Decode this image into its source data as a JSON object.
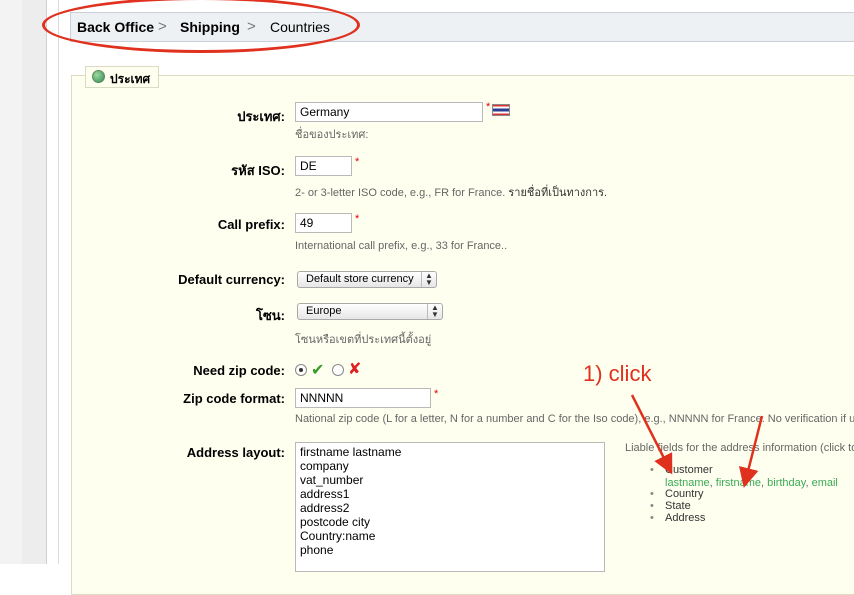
{
  "breadcrumb": {
    "items": [
      "Back Office",
      "Shipping",
      "Countries"
    ],
    "separator": ">"
  },
  "panel": {
    "legend": "ประเทศ"
  },
  "form": {
    "country": {
      "label": "ประเทศ:",
      "value": "Germany",
      "hint": "ชื่อของประเทศ:"
    },
    "iso": {
      "label": "รหัส ISO:",
      "value": "DE",
      "hint": "2- or 3-letter ISO code, e.g., FR for France.",
      "hint_link": "รายชื่อที่เป็นทางการ."
    },
    "call_prefix": {
      "label": "Call prefix:",
      "value": "49",
      "hint": "International call prefix, e.g., 33 for France.."
    },
    "default_currency": {
      "label": "Default currency:",
      "selected": "Default store currency"
    },
    "zone": {
      "label": "โซน:",
      "selected": "Europe",
      "hint": "โซนหรือเขตที่ประเทศนี้ตั้งอยู่"
    },
    "need_zip": {
      "label": "Need zip code:",
      "selected": "yes"
    },
    "zip_format": {
      "label": "Zip code format:",
      "value": "NNNNN",
      "hint": "National zip code (L for a letter, N for a number and C for the Iso code), e.g., NNNNN for France. No verification if u"
    },
    "address_layout": {
      "label": "Address layout:",
      "lines": [
        "firstname lastname",
        "company",
        "vat_number",
        "address1",
        "address2",
        "postcode city",
        "Country:name",
        "phone"
      ]
    },
    "liable_fields": {
      "intro": "Liable fields for the address information (click to",
      "items": [
        "Customer",
        "Country",
        "State",
        "Address"
      ],
      "customer_fields": [
        "lastname",
        "firstname",
        "birthday",
        "email"
      ]
    }
  },
  "annotation": {
    "text": "1) click",
    "color": "#e0301e"
  },
  "colors": {
    "required": "#dd0000",
    "accent_green": "#3aaa55",
    "panel_bg": "#fffff0"
  },
  "icons": [
    "globe-icon",
    "thai-flag-icon",
    "checkmark-icon",
    "cross-icon",
    "select-arrows-icon"
  ]
}
